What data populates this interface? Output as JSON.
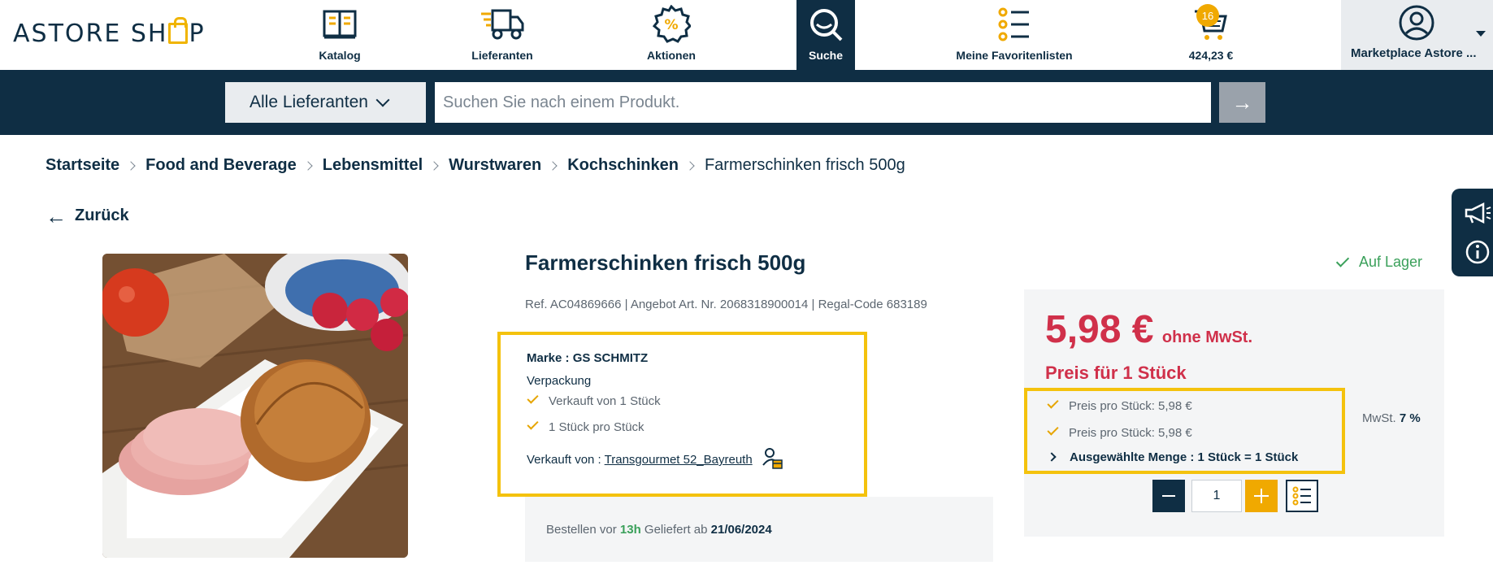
{
  "header": {
    "logo": "ASTORE SHOP",
    "nav": {
      "katalog": "Katalog",
      "lieferanten": "Lieferanten",
      "aktionen": "Aktionen",
      "suche": "Suche",
      "favoriten": "Meine Favoritenlisten",
      "cart_total": "424,23 €"
    },
    "cart_count": "16",
    "account_label": "Marketplace Astore ..."
  },
  "search": {
    "supplier_filter": "Alle Lieferanten",
    "placeholder": "Suchen Sie nach einem Produkt.",
    "go_symbol": "→"
  },
  "breadcrumb": [
    "Startseite",
    "Food and Beverage",
    "Lebensmittel",
    "Wurstwaren",
    "Kochschinken",
    "Farmerschinken frisch 500g"
  ],
  "back_label": "Zurück",
  "product": {
    "title": "Farmerschinken frisch 500g",
    "ref_line": "Ref. AC04869666 | Angebot Art. Nr. 2068318900014 | Regal-Code 683189",
    "stock": "Auf Lager",
    "brand": "Marke : GS SCHMITZ",
    "packaging_label": "Verpackung",
    "packaging_items": [
      "Verkauft von 1 Stück",
      "1 Stück pro Stück"
    ],
    "sold_by_label": "Verkauft von :",
    "seller": "Transgourmet 52_Bayreuth"
  },
  "delivery": {
    "order_before": "Bestellen vor",
    "hours": "13h",
    "delivered_from": "Geliefert ab",
    "date": "21/06/2024"
  },
  "price": {
    "amount": "5,98 €",
    "tax_note": "ohne MwSt.",
    "per_unit_label": "Preis für 1 Stück",
    "details": [
      "Preis pro Stück: 5,98 €",
      "Preis pro Stück: 5,98 €"
    ],
    "selected_qty": "Ausgewählte Menge : 1 Stück = 1 Stück",
    "vat_label": "MwSt.",
    "vat_value": "7 %",
    "quantity": "1"
  },
  "colors": {
    "navy": "#0f2e44",
    "accent_yellow": "#f0a900",
    "price_red": "#d0304a",
    "stock_green": "#3aa05a",
    "highlight_border": "#f4c20d"
  },
  "icons": [
    "book-icon",
    "truck-icon",
    "discount-badge-icon",
    "search-icon",
    "list-icon",
    "cart-icon",
    "user-icon",
    "megaphone-icon",
    "info-icon",
    "seller-icon",
    "checkmark-icon",
    "arrow-left-icon",
    "arrow-right-icon",
    "chevron-down-icon",
    "chevron-right-icon",
    "minus-icon",
    "plus-icon",
    "add-to-list-icon"
  ]
}
